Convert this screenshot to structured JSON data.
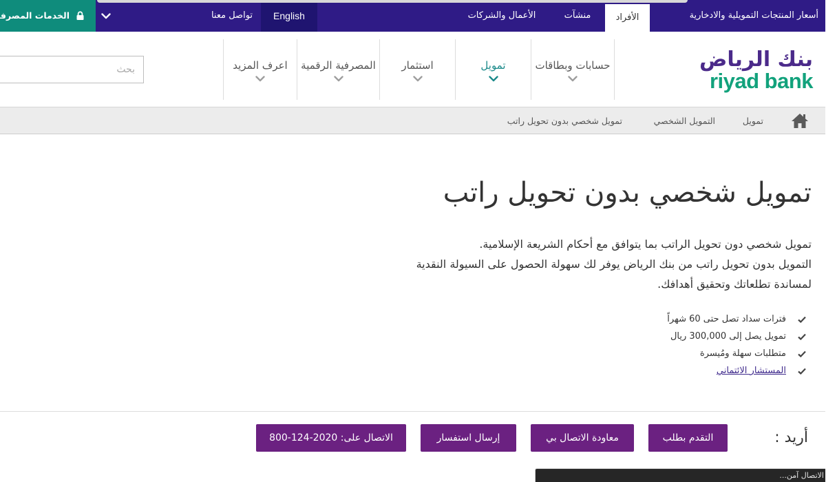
{
  "topbar": {
    "rates": "أسعار المنتجات التمويلية والادخارية",
    "tabs": [
      {
        "label": "الأفراد",
        "active": true
      },
      {
        "label": "منشآت",
        "active": false
      },
      {
        "label": "الأعمال والشركات",
        "active": false
      }
    ],
    "language": "English",
    "contact": "تواصل معنا",
    "online_banking": "الخدمات المصرفية"
  },
  "header": {
    "logo": {
      "arabic": "بنك الرياض",
      "latin": "riyad bank"
    },
    "nav": [
      {
        "label": "حسابات وبطاقات",
        "active": false
      },
      {
        "label": "تمويل",
        "active": true
      },
      {
        "label": "استثمار",
        "active": false
      },
      {
        "label": "المصرفية الرقمية",
        "active": false
      },
      {
        "label": "اعرف المزيد",
        "active": false
      }
    ],
    "search": {
      "placeholder": "بحث",
      "value": ""
    }
  },
  "breadcrumb": [
    {
      "label": "تمويل"
    },
    {
      "label": "التمويل الشخصي"
    },
    {
      "label": "تمويل شخصي بدون تحويل راتب",
      "current": true
    }
  ],
  "main": {
    "title": "تمويل شخصي بدون تحويل راتب",
    "intro_lines": [
      "تمويل شخصي دون تحويل الراتب بما يتوافق مع أحكام الشريعة الإسلامية.",
      "التمويل بدون تحويل راتب من بنك الرياض يوفر لك سهولة الحصول على السيولة النقدية",
      "لمساندة تطلعاتك وتحقيق أهدافك."
    ],
    "features": [
      {
        "text": "فترات سداد تصل حتى 60 شهراً"
      },
      {
        "text": "تمويل يصل إلى 300,000 ريال"
      },
      {
        "text": "متطلبات سهلة ومُيسرة"
      },
      {
        "text": "المستشار الائتماني",
        "link": true
      }
    ]
  },
  "actions": {
    "label": "أريد :",
    "buttons": [
      {
        "label": "التقدم بطلب"
      },
      {
        "label": "معاودة الاتصال بي"
      },
      {
        "label": "إرسال استفسار"
      },
      {
        "label": "الاتصال على: 2020-124-800"
      }
    ]
  },
  "status_bar": {
    "text": "الاتصال آمن..."
  },
  "icons": {
    "online_banking": "lock-icon",
    "dropdown": "chevron-down-icon",
    "breadcrumb_home": "home-icon",
    "feature_bullet": "check-icon"
  },
  "colors": {
    "top_bar": "#2f1b86",
    "english_block": "#1f1470",
    "online_banking": "#0f8c7c",
    "logo_arabic": "#4b2a8a",
    "logo_latin": "#12a27c",
    "nav_active": "#1b8a8a",
    "action_button": "#6b2181",
    "link": "#3f2a8c"
  }
}
